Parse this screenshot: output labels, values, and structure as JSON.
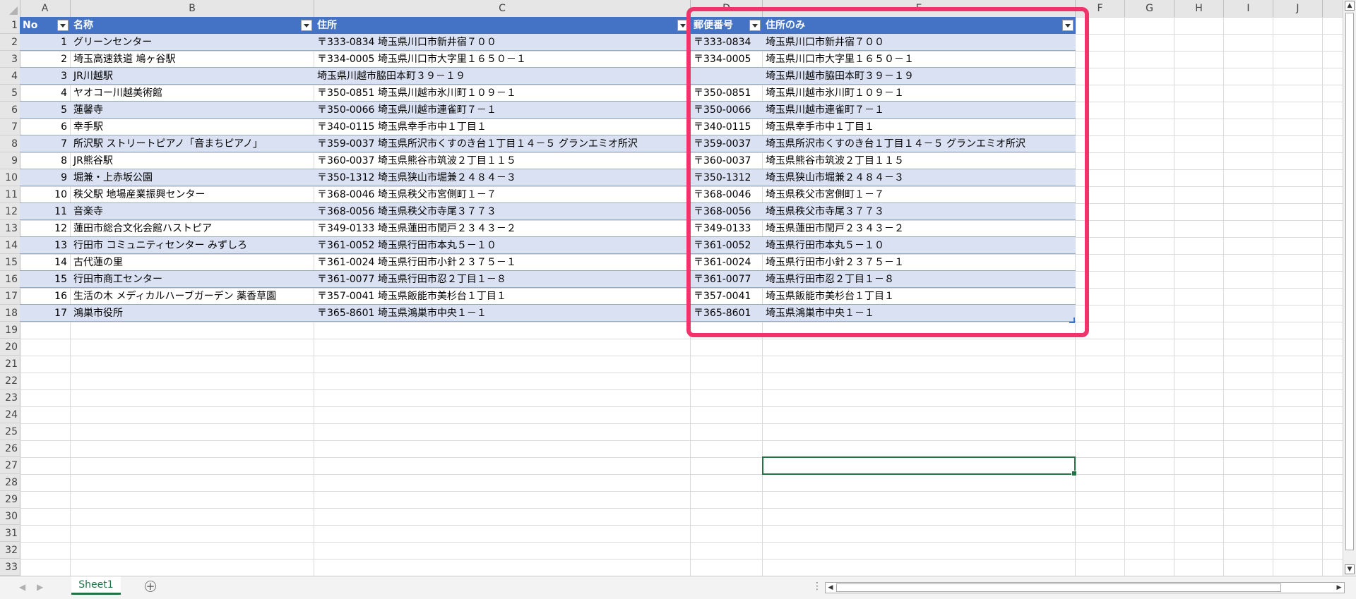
{
  "columns": [
    "A",
    "B",
    "C",
    "D",
    "E",
    "F",
    "G",
    "H",
    "I",
    "J"
  ],
  "row_numbers": [
    1,
    2,
    3,
    4,
    5,
    6,
    7,
    8,
    9,
    10,
    11,
    12,
    13,
    14,
    15,
    16,
    17,
    18,
    19,
    20,
    21,
    22,
    23,
    24,
    25,
    26,
    27,
    28,
    29,
    30,
    31,
    32,
    33
  ],
  "table": {
    "headers": [
      "No",
      "名称",
      "住所",
      "郵便番号",
      "住所のみ"
    ],
    "rows": [
      [
        "1",
        "グリーンセンター",
        "〒333-0834 埼玉県川口市新井宿７００",
        "〒333-0834",
        "埼玉県川口市新井宿７００"
      ],
      [
        "2",
        "埼玉高速鉄道 鳩ヶ谷駅",
        "〒334-0005 埼玉県川口市大字里１６５０－１",
        "〒334-0005",
        "埼玉県川口市大字里１６５０－１"
      ],
      [
        "3",
        "JR川越駅",
        "埼玉県川越市脇田本町３９－１９",
        "",
        "埼玉県川越市脇田本町３９－１９"
      ],
      [
        "4",
        "ヤオコー川越美術館",
        "〒350-0851 埼玉県川越市氷川町１０９－１",
        "〒350-0851",
        "埼玉県川越市氷川町１０９－１"
      ],
      [
        "5",
        "蓮馨寺",
        "〒350-0066 埼玉県川越市連雀町７－１",
        "〒350-0066",
        "埼玉県川越市連雀町７－１"
      ],
      [
        "6",
        "幸手駅",
        "〒340-0115 埼玉県幸手市中１丁目１",
        "〒340-0115",
        "埼玉県幸手市中１丁目１"
      ],
      [
        "7",
        "所沢駅 ストリートピアノ「音まちピアノ」",
        "〒359-0037 埼玉県所沢市くすのき台１丁目１４－５ グランエミオ所沢",
        "〒359-0037",
        "埼玉県所沢市くすのき台１丁目１４－５ グランエミオ所沢"
      ],
      [
        "8",
        "JR熊谷駅",
        "〒360-0037 埼玉県熊谷市筑波２丁目１１５",
        "〒360-0037",
        "埼玉県熊谷市筑波２丁目１１５"
      ],
      [
        "9",
        "堀兼・上赤坂公園",
        "〒350-1312 埼玉県狭山市堀兼２４８４－３",
        "〒350-1312",
        "埼玉県狭山市堀兼２４８４－３"
      ],
      [
        "10",
        "秩父駅 地場産業振興センター",
        "〒368-0046 埼玉県秩父市宮側町１－７",
        "〒368-0046",
        "埼玉県秩父市宮側町１－７"
      ],
      [
        "11",
        "音楽寺",
        "〒368-0056 埼玉県秩父市寺尾３７７３",
        "〒368-0056",
        "埼玉県秩父市寺尾３７７３"
      ],
      [
        "12",
        "蓮田市総合文化会館ハストピア",
        "〒349-0133 埼玉県蓮田市閏戸２３４３－２",
        "〒349-0133",
        "埼玉県蓮田市閏戸２３４３－２"
      ],
      [
        "13",
        "行田市 コミュニティセンター みずしろ",
        "〒361-0052 埼玉県行田市本丸５－１０",
        "〒361-0052",
        "埼玉県行田市本丸５－１０"
      ],
      [
        "14",
        "古代蓮の里",
        "〒361-0024 埼玉県行田市小針２３７５－１",
        "〒361-0024",
        "埼玉県行田市小針２３７５－１"
      ],
      [
        "15",
        "行田市商工センター",
        "〒361-0077 埼玉県行田市忍２丁目１－８",
        "〒361-0077",
        "埼玉県行田市忍２丁目１－８"
      ],
      [
        "16",
        "生活の木 メディカルハーブガーデン 薬香草園",
        "〒357-0041 埼玉県飯能市美杉台１丁目１",
        "〒357-0041",
        "埼玉県飯能市美杉台１丁目１"
      ],
      [
        "17",
        "鴻巣市役所",
        "〒365-8601 埼玉県鴻巣市中央１－１",
        "〒365-8601",
        "埼玉県鴻巣市中央１－１"
      ]
    ]
  },
  "sheet_tab": "Sheet1",
  "selected_cell": "E27",
  "colors": {
    "header_blue": "#4472c4",
    "band": "#d9e1f2",
    "highlight": "#f0336a",
    "excel_green": "#217346"
  }
}
